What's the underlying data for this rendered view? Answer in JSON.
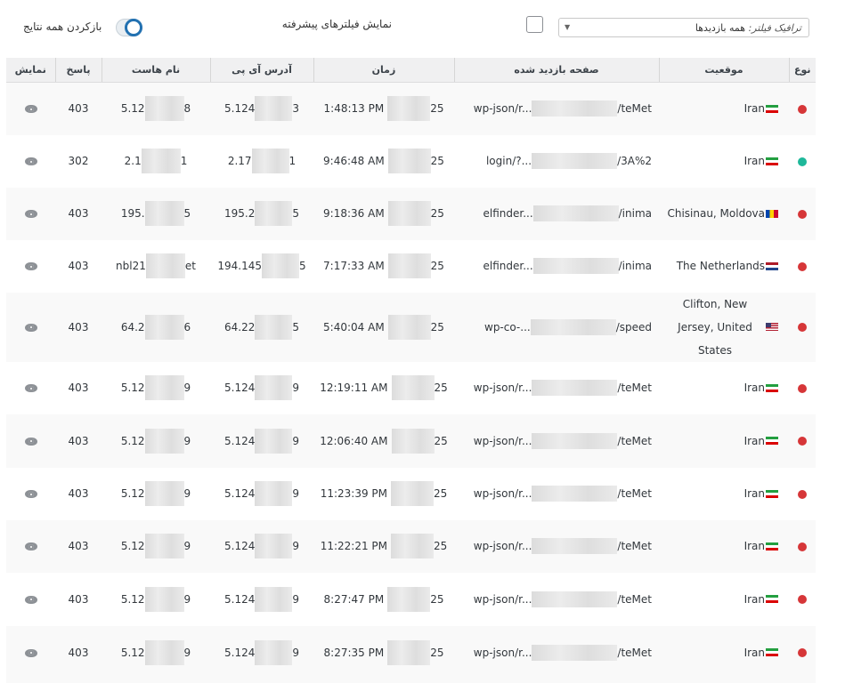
{
  "toolbar": {
    "filter_prefix": "ترافیک فیلتر:",
    "filter_value": "همه بازدیدها",
    "advanced_filters_label": "نمایش فیلترهای پیشرفته",
    "reset_label": "بازکردن همه نتایج"
  },
  "table": {
    "headers": {
      "type": "نوع",
      "location": "موقعیت",
      "page": "صفحه بازدید شده",
      "time": "زمان",
      "ip": "آدرس آی پی",
      "host": "نام هاست",
      "response": "پاسخ",
      "view": "نمایش"
    },
    "rows": [
      {
        "type_color": "#d63638",
        "location": "Iran",
        "flag": "ir",
        "page_pre": "wp-json/r...",
        "page_post": "/teMet",
        "time_pre": "25",
        "time": "1:48:13 PM",
        "ip_pre": "5.124",
        "ip_post": "3",
        "host_pre": "5.12",
        "host_post": "8",
        "response": "403",
        "view_icon": "eye-icon"
      },
      {
        "type_color": "#1eb89a",
        "location": "Iran",
        "flag": "ir",
        "page_pre": "login/?...",
        "page_post": "/3A%2",
        "time_pre": "25",
        "time": "9:46:48 AM",
        "ip_pre": "2.17",
        "ip_post": "1",
        "host_pre": "2.1",
        "host_post": "1",
        "response": "302",
        "view_icon": "eye-icon"
      },
      {
        "type_color": "#d63638",
        "location": "Chisinau, Moldova",
        "flag": "md",
        "page_pre": "elfinder...",
        "page_post": "/inima",
        "time_pre": "25",
        "time": "9:18:36 AM",
        "ip_pre": "195.2",
        "ip_post": "5",
        "host_pre": "195.",
        "host_post": "5",
        "response": "403",
        "view_icon": "eye-icon"
      },
      {
        "type_color": "#d63638",
        "location": "The Netherlands",
        "flag": "nl",
        "page_pre": "elfinder...",
        "page_post": "/inima",
        "time_pre": "25",
        "time": "7:17:33 AM",
        "ip_pre": "194.145",
        "ip_post": "5",
        "host_pre": "nbl21",
        "host_post": "et",
        "response": "403",
        "view_icon": "eye-icon"
      },
      {
        "type_color": "#d63638",
        "location": "Clifton, New Jersey, United States",
        "flag": "us",
        "page_pre": "wp-co-...",
        "page_post": "/speed",
        "time_pre": "25",
        "time": "5:40:04 AM",
        "ip_pre": "64.22",
        "ip_post": "5",
        "host_pre": "64.2",
        "host_post": "6",
        "response": "403",
        "view_icon": "eye-icon"
      },
      {
        "type_color": "#d63638",
        "location": "Iran",
        "flag": "ir",
        "page_pre": "wp-json/r...",
        "page_post": "/teMet",
        "time_pre": "25",
        "time": "12:19:11 AM",
        "ip_pre": "5.124",
        "ip_post": "9",
        "host_pre": "5.12",
        "host_post": "9",
        "response": "403",
        "view_icon": "eye-icon"
      },
      {
        "type_color": "#d63638",
        "location": "Iran",
        "flag": "ir",
        "page_pre": "wp-json/r...",
        "page_post": "/teMet",
        "time_pre": "25",
        "time": "12:06:40 AM",
        "ip_pre": "5.124",
        "ip_post": "9",
        "host_pre": "5.12",
        "host_post": "9",
        "response": "403",
        "view_icon": "eye-icon"
      },
      {
        "type_color": "#d63638",
        "location": "Iran",
        "flag": "ir",
        "page_pre": "wp-json/r...",
        "page_post": "/teMet",
        "time_pre": "25",
        "time": "11:23:39 PM",
        "ip_pre": "5.124",
        "ip_post": "9",
        "host_pre": "5.12",
        "host_post": "9",
        "response": "403",
        "view_icon": "eye-icon"
      },
      {
        "type_color": "#d63638",
        "location": "Iran",
        "flag": "ir",
        "page_pre": "wp-json/r...",
        "page_post": "/teMet",
        "time_pre": "25",
        "time": "11:22:21 PM",
        "ip_pre": "5.124",
        "ip_post": "9",
        "host_pre": "5.12",
        "host_post": "9",
        "response": "403",
        "view_icon": "eye-icon"
      },
      {
        "type_color": "#d63638",
        "location": "Iran",
        "flag": "ir",
        "page_pre": "wp-json/r...",
        "page_post": "/teMet",
        "time_pre": "25",
        "time": "8:27:47 PM",
        "ip_pre": "5.124",
        "ip_post": "9",
        "host_pre": "5.12",
        "host_post": "9",
        "response": "403",
        "view_icon": "eye-icon"
      },
      {
        "type_color": "#d63638",
        "location": "Iran",
        "flag": "ir",
        "page_pre": "wp-json/r...",
        "page_post": "/teMet",
        "time_pre": "25",
        "time": "8:27:35 PM",
        "ip_pre": "5.124",
        "ip_post": "9",
        "host_pre": "5.12",
        "host_post": "9",
        "response": "403",
        "view_icon": "eye-icon"
      }
    ]
  }
}
